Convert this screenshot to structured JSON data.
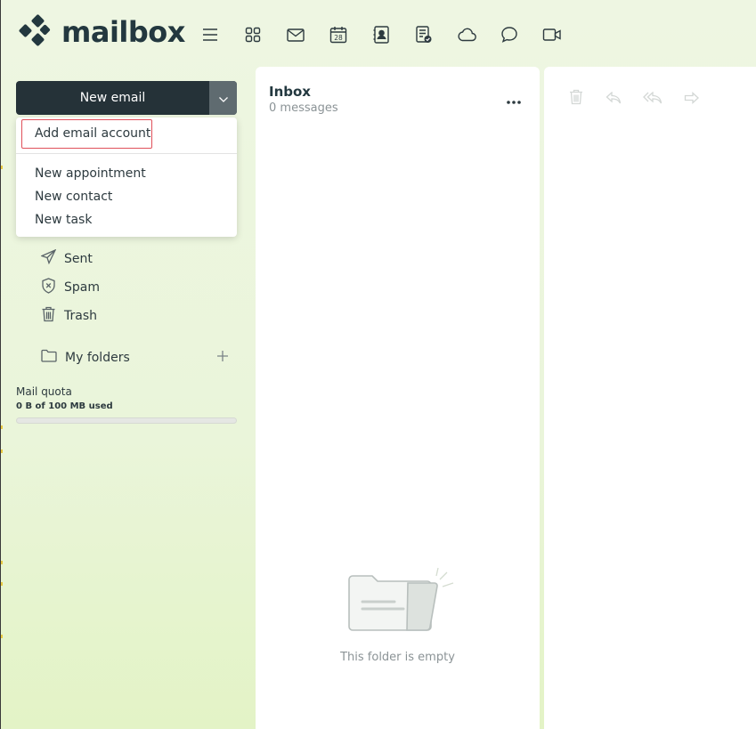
{
  "app": {
    "logo_text": "mailbox"
  },
  "topnav": {
    "icons": [
      "menu-icon",
      "apps-icon",
      "mail-icon",
      "calendar-icon",
      "contacts-icon",
      "tasks-icon",
      "cloud-icon",
      "chat-icon",
      "video-icon"
    ],
    "calendar_day": "28"
  },
  "compose": {
    "new_email_label": "New email",
    "dropdown_items": {
      "add_account": "Add email account",
      "new_appointment": "New appointment",
      "new_contact": "New contact",
      "new_task": "New task"
    }
  },
  "folders": {
    "sent": "Sent",
    "spam": "Spam",
    "trash": "Trash",
    "my_folders": "My folders"
  },
  "quota": {
    "title": "Mail quota",
    "used_text": "0 B of 100 MB used",
    "used_fraction": 0
  },
  "inbox": {
    "title": "Inbox",
    "count": "0 messages",
    "empty_text": "This folder is empty"
  },
  "colors": {
    "accent_dark": "#253238",
    "highlight_border": "#e0505a",
    "background_green": "#eaf5da"
  }
}
